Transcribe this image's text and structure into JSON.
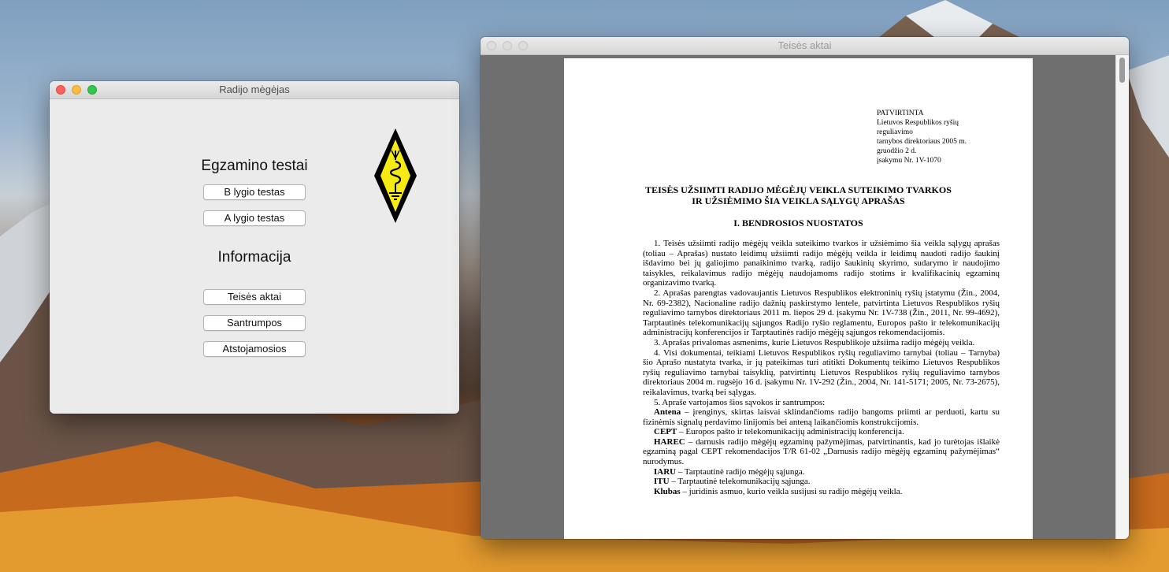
{
  "main_window": {
    "title": "Radijo mėgėjas",
    "exam_heading": "Egzamino testai",
    "exam_buttons": [
      "B lygio testas",
      "A lygio testas"
    ],
    "info_heading": "Informacija",
    "info_buttons": [
      "Teisės aktai",
      "Santrumpos",
      "Atstojamosios"
    ],
    "logo": "radio-amateur-diamond-logo"
  },
  "doc_window": {
    "title": "Teisės aktai",
    "approval": [
      "PATVIRTINTA",
      "Lietuvos Respublikos ryšių",
      "reguliavimo",
      "tarnybos direktoriaus 2005 m.",
      "gruodžio 2 d.",
      "įsakymu Nr. 1V-1070"
    ],
    "title_line1": "TEISĖS UŽSIIMTI RADIJO MĖGĖJŲ VEIKLA SUTEIKIMO TVARKOS",
    "title_line2": "IR UŽSIĖMIMO ŠIA VEIKLA SĄLYGŲ APRAŠAS",
    "section": "I. BENDROSIOS NUOSTATOS",
    "p1": "1. Teisės užsiimti radijo mėgėjų veikla suteikimo tvarkos ir užsiėmimo šia veikla sąlygų aprašas (toliau – Aprašas) nustato leidimų užsiimti radijo mėgėjų veikla ir leidimų naudoti radijo šaukinį išdavimo bei jų galiojimo panaikinimo tvarką, radijo šaukinių skyrimo, sudarymo ir naudojimo taisykles, reikalavimus radijo mėgėjų naudojamoms radijo stotims ir kvalifikacinių egzaminų organizavimo tvarką.",
    "p2": "2. Aprašas parengtas vadovaujantis Lietuvos Respublikos elektroninių ryšių įstatymu (Žin., 2004, Nr. 69-2382), Nacionaline radijo dažnių paskirstymo lentele, patvirtinta Lietuvos Respublikos ryšių reguliavimo tarnybos direktoriaus 2011 m. liepos 29 d. įsakymu Nr. 1V-738 (Žin., 2011, Nr. 99-4692), Tarptautinės telekomunikacijų sąjungos Radijo ryšio reglamentu, Europos pašto ir telekomunikacijų administracijų konferencijos ir Tarptautinės radijo mėgėjų sąjungos rekomendacijomis.",
    "p3": "3. Aprašas privalomas asmenims, kurie Lietuvos Respublikoje užsiima radijo mėgėjų veikla.",
    "p4": "4. Visi dokumentai, teikiami Lietuvos Respublikos ryšių reguliavimo tarnybai (toliau – Tarnyba) šio Aprašo nustatyta tvarka, ir jų pateikimas turi atitikti Dokumentų teikimo Lietuvos Respublikos ryšių reguliavimo tarnybai taisyklių, patvirtintų Lietuvos Respublikos ryšių reguliavimo tarnybos direktoriaus 2004 m. rugsėjo 16 d. įsakymu Nr. 1V-292 (Žin., 2004, Nr. 141-5171; 2005, Nr. 73-2675), reikalavimus, tvarką bei sąlygas.",
    "p5": "5. Apraše vartojamos šios sąvokos ir santrumpos:",
    "defs": [
      {
        "term": "Antena",
        "text": " – įrenginys, skirtas laisvai sklindančioms radijo bangoms priimti ar perduoti, kartu su fizinėmis signalų perdavimo linijomis bei anteną laikančiomis konstrukcijomis."
      },
      {
        "term": "CEPT",
        "text": " – Europos pašto ir telekomunikacijų administracijų konferencija."
      },
      {
        "term": "HAREC",
        "text": " – darnusis radijo mėgėjų egzaminų pažymėjimas, patvirtinantis, kad jo turėtojas išlaikė egzaminą pagal CEPT rekomendacijos T/R 61-02 „Darnusis radijo mėgėjų egzaminų pažymėjimas“ nurodymus."
      },
      {
        "term": "IARU",
        "text": " – Tarptautinė radijo mėgėjų sąjunga."
      },
      {
        "term": "ITU",
        "text": " – Tarptautinė telekomunikacijų sąjunga."
      },
      {
        "term": "Klubas",
        "text": " – juridinis asmuo, kurio veikla susijusi su radijo mėgėjų veikla."
      }
    ]
  }
}
